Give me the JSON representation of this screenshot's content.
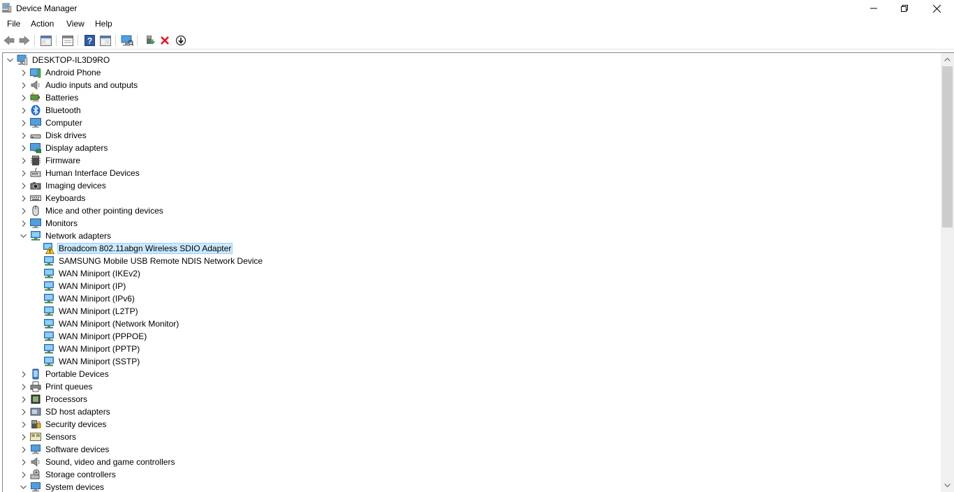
{
  "window": {
    "title": "Device Manager"
  },
  "menu": [
    "File",
    "Action",
    "View",
    "Help"
  ],
  "toolbar": {
    "buttons": [
      "back-arrow-icon",
      "forward-arrow-icon",
      "show-hide-console-tree-icon",
      "properties-icon",
      "help-icon",
      "action-pane-icon",
      "scan-hardware-icon",
      "update-driver-icon",
      "uninstall-x-icon",
      "disable-device-icon"
    ]
  },
  "tree": {
    "root": "DESKTOP-IL3D9RO",
    "categories": [
      {
        "label": "Android Phone",
        "icon": "phone-icon"
      },
      {
        "label": "Audio inputs and outputs",
        "icon": "speaker-icon"
      },
      {
        "label": "Batteries",
        "icon": "battery-icon"
      },
      {
        "label": "Bluetooth",
        "icon": "bluetooth-icon"
      },
      {
        "label": "Computer",
        "icon": "computer-icon"
      },
      {
        "label": "Disk drives",
        "icon": "disk-icon"
      },
      {
        "label": "Display adapters",
        "icon": "display-adapter-icon"
      },
      {
        "label": "Firmware",
        "icon": "firmware-icon"
      },
      {
        "label": "Human Interface Devices",
        "icon": "hid-icon"
      },
      {
        "label": "Imaging devices",
        "icon": "camera-icon"
      },
      {
        "label": "Keyboards",
        "icon": "keyboard-icon"
      },
      {
        "label": "Mice and other pointing devices",
        "icon": "mouse-icon"
      },
      {
        "label": "Monitors",
        "icon": "monitor-icon"
      },
      {
        "label": "Network adapters",
        "icon": "network-icon",
        "expanded": true,
        "children": [
          {
            "label": "Broadcom 802.11abgn Wireless SDIO Adapter",
            "warning": true,
            "selected": true
          },
          {
            "label": "SAMSUNG Mobile USB Remote NDIS Network Device"
          },
          {
            "label": "WAN Miniport (IKEv2)"
          },
          {
            "label": "WAN Miniport (IP)"
          },
          {
            "label": "WAN Miniport (IPv6)"
          },
          {
            "label": "WAN Miniport (L2TP)"
          },
          {
            "label": "WAN Miniport (Network Monitor)"
          },
          {
            "label": "WAN Miniport (PPPOE)"
          },
          {
            "label": "WAN Miniport (PPTP)"
          },
          {
            "label": "WAN Miniport (SSTP)"
          }
        ]
      },
      {
        "label": "Portable Devices",
        "icon": "portable-device-icon"
      },
      {
        "label": "Print queues",
        "icon": "printer-icon"
      },
      {
        "label": "Processors",
        "icon": "processor-icon"
      },
      {
        "label": "SD host adapters",
        "icon": "sd-card-icon"
      },
      {
        "label": "Security devices",
        "icon": "security-device-icon"
      },
      {
        "label": "Sensors",
        "icon": "sensor-icon"
      },
      {
        "label": "Software devices",
        "icon": "software-device-icon"
      },
      {
        "label": "Sound, video and game controllers",
        "icon": "sound-icon"
      },
      {
        "label": "Storage controllers",
        "icon": "storage-controller-icon"
      },
      {
        "label": "System devices",
        "icon": "system-device-icon",
        "expanded": true
      }
    ]
  },
  "colors": {
    "selection_bg": "#cce8ff",
    "selection_border": "#99d1ff",
    "network_icon": "#3a8fd6",
    "uninstall_red": "#e81123"
  }
}
